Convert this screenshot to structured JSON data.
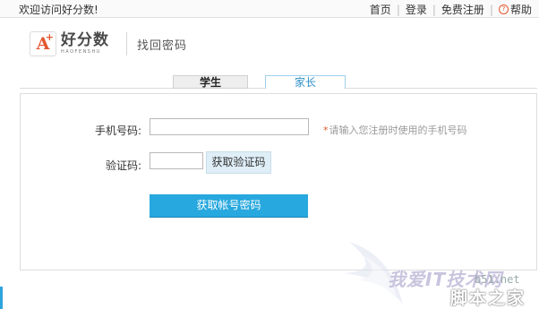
{
  "topbar": {
    "welcome": "欢迎访问好分数!",
    "links": {
      "home": "首页",
      "login": "登录",
      "register": "免费注册",
      "help": "帮助"
    },
    "separator": "|"
  },
  "header": {
    "logo_mark": "A",
    "logo_plus": "+",
    "logo_cn": "好分数",
    "logo_en": "HAOFENSHU",
    "page_title": "找回密码"
  },
  "tabs": [
    {
      "label": "学生",
      "active": false
    },
    {
      "label": "家长",
      "active": true
    }
  ],
  "form": {
    "phone_label": "手机号码:",
    "phone_value": "",
    "phone_hint_star": "*",
    "phone_hint": "请输入您注册时使用的手机号码",
    "code_label": "验证码:",
    "code_value": "",
    "get_code_button": "获取验证码",
    "submit_button": "获取帐号密码"
  },
  "watermark": {
    "brand": "我爱IT技术网",
    "site": "b51.net",
    "stamp": "脚本之家"
  },
  "colors": {
    "accent": "#27a8de",
    "brand_red": "#e4572e",
    "active_tab": "#2e8fc9"
  }
}
